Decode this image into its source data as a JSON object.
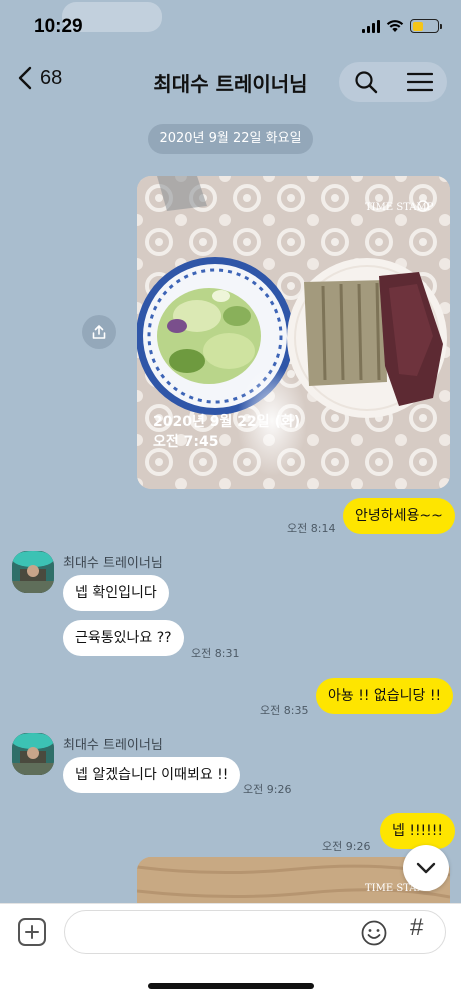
{
  "status": {
    "time": "10:29"
  },
  "header": {
    "back_count": "68",
    "title": "최대수 트레이너님"
  },
  "date_divider": "2020년 9월 22일 화요일",
  "photo": {
    "stamp_label": "TIME STAMP",
    "overlay_date": "2020년 9월 22일 (화)",
    "overlay_time": "오전 7:45"
  },
  "messages": [
    {
      "from": "me",
      "text": "안녕하세용~~",
      "time": "오전 8:14"
    },
    {
      "from": "trainer",
      "sender": "최대수 트레이너님",
      "text": "넵 확인입니다"
    },
    {
      "from": "trainer",
      "text": "근육통있나요 ??",
      "time": "오전 8:31"
    },
    {
      "from": "me",
      "text": "아뇽 !! 없습니당 !!",
      "time": "오전 8:35"
    },
    {
      "from": "trainer",
      "sender": "최대수 트레이너님",
      "text": "넵 알겠습니다 이때뵈요 !!",
      "time": "오전 9:26"
    },
    {
      "from": "me",
      "text": "넵 !!!!!!",
      "time": "오전 9:26"
    }
  ],
  "photo2": {
    "stamp_label": "TIME STAMP"
  },
  "input": {
    "placeholder": "",
    "value": ""
  },
  "icons": {
    "back": "chevron-left-icon",
    "search": "search-icon",
    "menu": "hamburger-menu-icon",
    "share": "share-icon",
    "scroll_down": "chevron-down-icon",
    "plus": "plus-icon",
    "emoji": "emoji-icon",
    "hash": "hashtag-icon"
  },
  "colors": {
    "chat_bg": "#a9bdce",
    "my_bubble": "#fee500",
    "their_bubble": "#ffffff"
  },
  "hash_symbol": "#"
}
